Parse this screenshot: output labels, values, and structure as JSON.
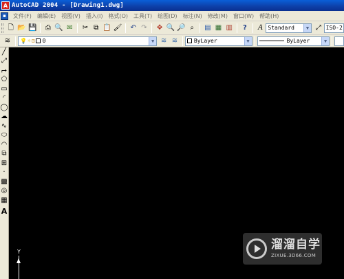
{
  "window": {
    "app_icon": "autocad-logo-icon",
    "title": "AutoCAD 2004 - [Drawing1.dwg]"
  },
  "menubar": {
    "items": [
      {
        "label": "文件(F)"
      },
      {
        "label": "编辑(E)"
      },
      {
        "label": "视图(V)"
      },
      {
        "label": "插入(I)"
      },
      {
        "label": "格式(O)"
      },
      {
        "label": "工具(T)"
      },
      {
        "label": "绘图(D)"
      },
      {
        "label": "标注(N)"
      },
      {
        "label": "修改(M)"
      },
      {
        "label": "窗口(W)"
      },
      {
        "label": "帮助(H)"
      }
    ]
  },
  "standard_toolbar": {
    "text_style": "Standard",
    "dim_style": "ISO-2"
  },
  "layers_toolbar": {
    "current_layer": "0"
  },
  "properties_toolbar": {
    "color": "ByLayer",
    "linetype": "ByLayer"
  },
  "canvas": {
    "ucs_y_label": "Y"
  },
  "watermark": {
    "text": "溜溜自学",
    "url": "ZIXUE.3D66.COM"
  },
  "colors": {
    "titlebar": "#0a3fa8",
    "canvas": "#000000",
    "chrome": "#ece9d8"
  }
}
